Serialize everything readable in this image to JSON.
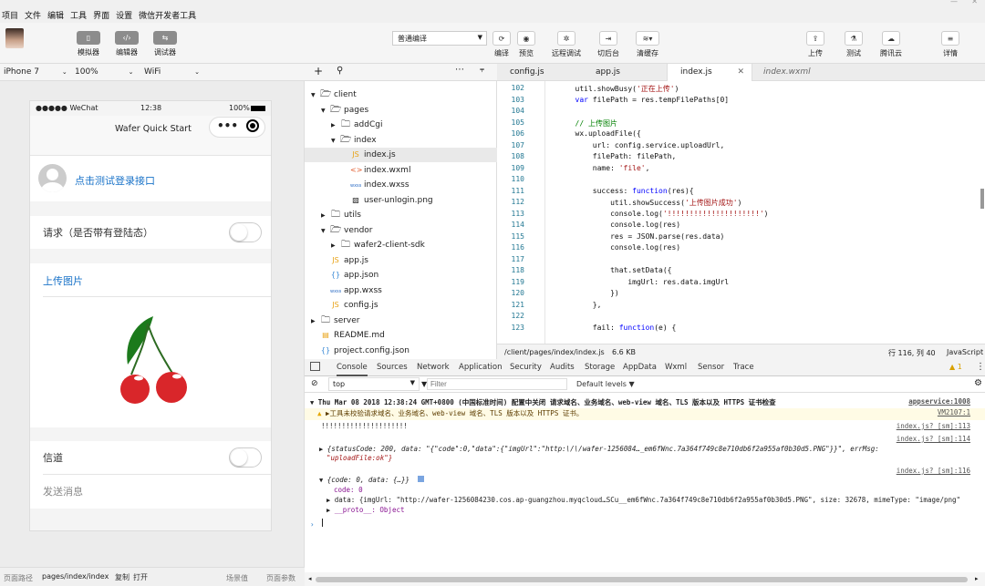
{
  "menubar": {
    "items": [
      "项目",
      "文件",
      "编辑",
      "工具",
      "界面",
      "设置",
      "微信开发者工具"
    ]
  },
  "toolbar": {
    "left_buttons": [
      {
        "icon": "phone-icon",
        "label": "模拟器"
      },
      {
        "icon": "code-icon",
        "label": "编辑器"
      },
      {
        "icon": "debug-icon",
        "label": "调试器"
      }
    ],
    "compile_mode": "普通编译",
    "center_buttons": [
      {
        "icon": "refresh-icon",
        "label": "编译"
      },
      {
        "icon": "eye-icon",
        "label": "预览"
      },
      {
        "icon": "bug-icon",
        "label": "远程调试"
      },
      {
        "icon": "switch-icon",
        "label": "切后台"
      },
      {
        "icon": "layers-icon",
        "label": "清缓存"
      }
    ],
    "right_buttons": [
      {
        "icon": "upload-icon",
        "label": "上传"
      },
      {
        "icon": "flask-icon",
        "label": "测试"
      },
      {
        "icon": "cloud-icon",
        "label": "腾讯云"
      },
      {
        "icon": "menu-icon",
        "label": "详情"
      }
    ]
  },
  "device": {
    "model": "iPhone 7",
    "zoom": "100%",
    "network": "WiFi"
  },
  "phone": {
    "carrier": "●●●●● WeChat",
    "time": "12:38",
    "battery": "100%",
    "nav_title": "Wafer Quick Start",
    "login_text": "点击测试登录接口",
    "request_label": "请求（是否带有登陆态）",
    "upload_label": "上传图片",
    "channel_label": "信道",
    "send_label": "发送消息"
  },
  "tree": {
    "nodes": [
      {
        "label": "client",
        "icon": "folder-open-icon",
        "arrow": "▼",
        "depth": 0
      },
      {
        "label": "pages",
        "icon": "folder-open-icon",
        "arrow": "▼",
        "depth": 1
      },
      {
        "label": "addCgi",
        "icon": "folder-icon",
        "arrow": "▶",
        "depth": 2
      },
      {
        "label": "index",
        "icon": "folder-open-icon",
        "arrow": "▼",
        "depth": 2
      },
      {
        "label": "index.js",
        "icon": "JS",
        "arrow": "",
        "depth": 3,
        "selected": true
      },
      {
        "label": "index.wxml",
        "icon": "<>",
        "arrow": "",
        "depth": 3
      },
      {
        "label": "index.wxss",
        "icon": "wxss",
        "arrow": "",
        "depth": 3
      },
      {
        "label": "user-unlogin.png",
        "icon": "▧",
        "arrow": "",
        "depth": 3
      },
      {
        "label": "utils",
        "icon": "folder-icon",
        "arrow": "▶",
        "depth": 1
      },
      {
        "label": "vendor",
        "icon": "folder-open-icon",
        "arrow": "▼",
        "depth": 1
      },
      {
        "label": "wafer2-client-sdk",
        "icon": "folder-icon",
        "arrow": "▶",
        "depth": 2
      },
      {
        "label": "app.js",
        "icon": "JS",
        "arrow": "",
        "depth": 1
      },
      {
        "label": "app.json",
        "icon": "{}",
        "arrow": "",
        "depth": 1
      },
      {
        "label": "app.wxss",
        "icon": "wxss",
        "arrow": "",
        "depth": 1
      },
      {
        "label": "config.js",
        "icon": "JS",
        "arrow": "",
        "depth": 1
      },
      {
        "label": "server",
        "icon": "folder-icon",
        "arrow": "▶",
        "depth": 0
      },
      {
        "label": "README.md",
        "icon": "▤",
        "arrow": "",
        "depth": 0
      },
      {
        "label": "project.config.json",
        "icon": "{}",
        "arrow": "",
        "depth": 0
      }
    ]
  },
  "editor": {
    "tabs": [
      {
        "label": "config.js",
        "active": false,
        "italic": false
      },
      {
        "label": "app.js",
        "active": false,
        "italic": false
      },
      {
        "label": "index.js",
        "active": true,
        "italic": false
      },
      {
        "label": "index.wxml",
        "active": false,
        "italic": true
      }
    ],
    "lines": [
      {
        "n": "102",
        "code": "        util.showBusy('正在上传')"
      },
      {
        "n": "103",
        "code": "        var filePath = res.tempFilePaths[0]"
      },
      {
        "n": "104",
        "code": ""
      },
      {
        "n": "105",
        "code": "        // 上传图片"
      },
      {
        "n": "106",
        "code": "        wx.uploadFile({"
      },
      {
        "n": "107",
        "code": "            url: config.service.uploadUrl,"
      },
      {
        "n": "108",
        "code": "            filePath: filePath,"
      },
      {
        "n": "109",
        "code": "            name: 'file',"
      },
      {
        "n": "110",
        "code": ""
      },
      {
        "n": "111",
        "code": "            success: function(res){"
      },
      {
        "n": "112",
        "code": "                util.showSuccess('上传图片成功')"
      },
      {
        "n": "113",
        "code": "                console.log('!!!!!!!!!!!!!!!!!!!!!')"
      },
      {
        "n": "114",
        "code": "                console.log(res)"
      },
      {
        "n": "115",
        "code": "                res = JSON.parse(res.data)"
      },
      {
        "n": "116",
        "code": "                console.log(res)"
      },
      {
        "n": "117",
        "code": ""
      },
      {
        "n": "118",
        "code": "                that.setData({"
      },
      {
        "n": "119",
        "code": "                    imgUrl: res.data.imgUrl"
      },
      {
        "n": "120",
        "code": "                })"
      },
      {
        "n": "121",
        "code": "            },"
      },
      {
        "n": "122",
        "code": ""
      },
      {
        "n": "123",
        "code": "            fail: function(e) {"
      }
    ],
    "status_path": "/client/pages/index/index.js",
    "status_size": "6.6 KB",
    "status_pos": "行 116, 列 40",
    "status_lang": "JavaScript"
  },
  "devtools": {
    "tabs": [
      "Console",
      "Sources",
      "Network",
      "Application",
      "Security",
      "Audits",
      "Storage",
      "AppData",
      "Wxml",
      "Sensor",
      "Trace"
    ],
    "warn_count": "1",
    "context": "top",
    "filter_placeholder": "Filter",
    "levels": "Default levels ▼",
    "messages": {
      "m1_text": "Thu Mar 08 2018 12:38:24 GMT+0800 (中国标准时间) 配置中关闭 请求域名、业务域名、web-view 域名、TLS 版本以及 HTTPS 证书检查",
      "m1_src": "appservice:1008",
      "m2_text": "▶工具未校验请求域名、业务域名、web-view 域名、TLS 版本以及 HTTPS 证书。",
      "m2_src": "VM2107:1",
      "m3_text": "!!!!!!!!!!!!!!!!!!!!!",
      "m3_src": "index.js? [sm]:113",
      "m4_src": "index.js? [sm]:114",
      "m4_text": "{statusCode: 200, data: \"{\"code\":0,\"data\":{\"imgUrl\":\"http:\\/\\/wafer-1256084…_em6fWnc.7a364f749c8e710db6f2a955af0b30d5.PNG\"}}\", errMsg:",
      "m4_text2": "\"uploadFile:ok\"}",
      "m5_src": "index.js? [sm]:116",
      "m5_text": "{code: 0, data: {…}}",
      "m5_code": "code: 0",
      "m5_data": "data: {imgUrl: \"http://wafer-1256084230.cos.ap-guangzhou.myqcloud…SCu__em6fWnc.7a364f749c8e710db6f2a955af0b30d5.PNG\", size: 32678, mimeType: \"image/png\"",
      "m5_proto": "__proto__: Object"
    }
  },
  "bottom": {
    "path_label": "页面路径",
    "path_value": "pages/index/index",
    "copy": "复制",
    "open": "打开",
    "scene": "场景值",
    "params": "页面参数"
  }
}
